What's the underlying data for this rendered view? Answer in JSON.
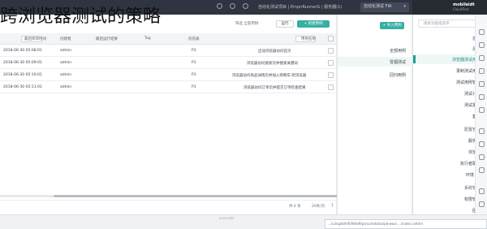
{
  "caption": "跨浏览器测试的策略",
  "topbar": {
    "user_label": "自动化测试 FIA",
    "info_text": "自动化测试项目 | EmpirRunnerG | 服务器(1)",
    "brand_title": "mobileidt",
    "brand_sub": "CloudTest"
  },
  "sidebar": {
    "search_placeholder": "搜索功能或菜单",
    "items": [
      {
        "label": "首页",
        "group": true
      },
      {
        "label": "测试",
        "group": false
      },
      {
        "label": "浏览器测试用例",
        "active": true
      },
      {
        "label": "录制测试用例",
        "group": false
      },
      {
        "label": "测试用例管理",
        "group": false
      },
      {
        "label": "测试计划",
        "group": false
      },
      {
        "label": "测试报告",
        "group": false
      },
      {
        "label": "套件",
        "group": false
      },
      {
        "label": "配置管理",
        "group": true
      },
      {
        "label": "服务器",
        "group": false
      },
      {
        "label": "浏览器",
        "group": false
      },
      {
        "label": "执行者配置",
        "group": false
      },
      {
        "label": "环境 git",
        "group": false
      },
      {
        "label": "系统管理",
        "group": true
      },
      {
        "label": "权限管理",
        "group": false
      },
      {
        "label": "团队",
        "group": false
      },
      {
        "label": "日志",
        "group": false
      }
    ]
  },
  "panel2": {
    "rows": [
      {
        "label": "全部用例",
        "selected": false
      },
      {
        "label": "冒烟测试",
        "selected": true
      },
      {
        "label": "回归用例",
        "selected": false
      }
    ]
  },
  "toolbar": {
    "new_label": "+ 新建用例",
    "run_label": "运行",
    "import_label": "+ 导入用例",
    "filter_text": "筛选 全部用例"
  },
  "table": {
    "headers": [
      "用例名称",
      "优先级",
      "Tag",
      "最后运行结果",
      "创建者",
      "最后修改时间"
    ],
    "rows": [
      {
        "name": "启动浏览器访问首页",
        "priority": "P1",
        "tag": "",
        "result": "",
        "creator": "admin",
        "time": "2018-06-30 05:08:01"
      },
      {
        "name": "浏览器访问搜索页并搜索关键词",
        "priority": "P1",
        "tag": "",
        "result": "",
        "creator": "admin",
        "time": "2018-06-30 05:09:01"
      },
      {
        "name": "浏览器访问商品详情页并加入购物车 跨浏览器",
        "priority": "P1",
        "tag": "",
        "result": "",
        "creator": "admin",
        "time": "2018-06-30 05:10:01"
      },
      {
        "name": "浏览器访问订单页并提交订单检查结果",
        "priority": "P1",
        "tag": "",
        "result": "",
        "creator": "admin",
        "time": "2018-06-30 05:11:01"
      }
    ]
  },
  "pager": {
    "total_text": "共 4 条",
    "size_text": "20条/页",
    "page_text": "1"
  },
  "status": {
    "url": ".../uiingdkhhfi/Webff/pe/coredatas/ptnews/..../index.cshtml",
    "middle": "ui.cs.ecls"
  }
}
